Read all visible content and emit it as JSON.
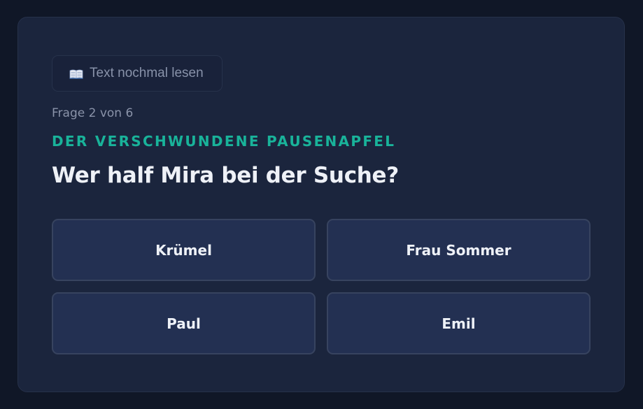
{
  "reread": {
    "label": "Text nochmal lesen",
    "icon": "open-book-icon"
  },
  "quiz": {
    "progress_text": "Frage 2 von 6",
    "story_title": "DER VERSCHWUNDENE PAUSENAPFEL",
    "question": "Wer half Mira bei der Suche?",
    "answers": [
      "Krümel",
      "Frau Sommer",
      "Paul",
      "Emil"
    ]
  },
  "colors": {
    "background": "#101727",
    "card": "#1b253d",
    "accent": "#19b39a",
    "answer_button": "#233052"
  }
}
